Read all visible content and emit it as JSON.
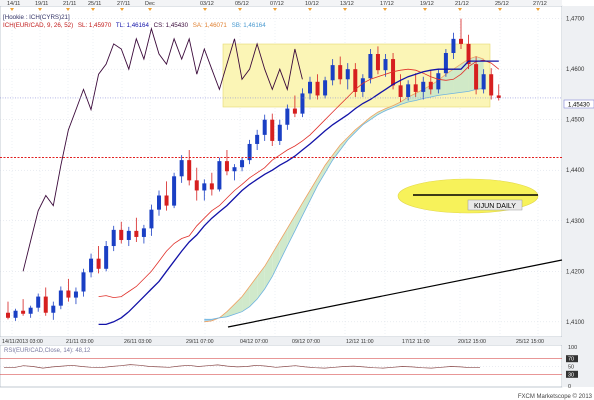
{
  "window": {
    "title_tag": "[Hookie : ICH(CYRS)21]"
  },
  "legend": {
    "ichimoku_line": "ICH(EUR/CAD, 9, 26, 52)",
    "sl_label": "SL: 1,45970",
    "tl_label": "TL: 1,46164",
    "cs_label": "CS: 1,45430",
    "sa_label": "SA: 1,46071",
    "sb_label": "SB: 1,46164"
  },
  "annotation": {
    "kijun_label": "KIJUN DAILY"
  },
  "rsi": {
    "label": "RSI(EUR/CAD,Close, 14): 48,12",
    "tick_labels": [
      "100",
      "70",
      "50",
      "30",
      "0"
    ],
    "ticks": [
      100,
      70,
      50,
      30,
      0
    ]
  },
  "footer": {
    "credit": "FXCM Marketscope © 2013"
  },
  "colors": {
    "candle_up": "#1a3fc4",
    "candle_down": "#d61f1f",
    "tenkan": "#e0302a",
    "kijun": "#1313a8",
    "chikou": "#3b0a3b",
    "cloud_bear": "#9fd4ef",
    "cloud_bull": "#cde8c8",
    "span_a": "#f0a060",
    "span_b": "#6fb3e0",
    "highlight_box": "#fbf5b6",
    "ellipse": "#f7f25a",
    "support_line": "#dd0000",
    "trendline": "#000000"
  },
  "chart_data": {
    "type": "candlestick",
    "instrument": "EUR/CAD",
    "y_ticks": [
      1.41,
      1.42,
      1.43,
      1.44,
      1.45,
      1.46,
      1.47
    ],
    "y_tick_labels": [
      "1,4100",
      "1,4200",
      "1,4300",
      "1,4400",
      "1,4500",
      "1,4600",
      "1,4700"
    ],
    "ylim": [
      1.407,
      1.4725
    ],
    "current_price": 1.4543,
    "current_price_label": "1,45430",
    "horizontal_support": 1.4425,
    "top_date_labels": [
      "14/11",
      "19/11",
      "21/11",
      "25/11",
      "27/11",
      "Dec",
      "03/12",
      "05/12",
      "07/12",
      "10/12",
      "13/12",
      "17/12",
      "19/12",
      "21/12",
      "25/12",
      "27/12"
    ],
    "bottom_date_labels": [
      "14/11/2013 03:00",
      "21/11 03:00",
      "26/11 03:00",
      "29/11 07:00",
      "04/12 07:00",
      "09/12 07:00",
      "12/12 11:00",
      "17/12 11:00",
      "20/12 15:00",
      "25/12 15:00"
    ],
    "candles": [
      {
        "o": 1.4118,
        "h": 1.414,
        "l": 1.4105,
        "c": 1.4108
      },
      {
        "o": 1.4108,
        "h": 1.4126,
        "l": 1.4102,
        "c": 1.4122
      },
      {
        "o": 1.4122,
        "h": 1.4145,
        "l": 1.4112,
        "c": 1.4116
      },
      {
        "o": 1.4116,
        "h": 1.4132,
        "l": 1.4108,
        "c": 1.4128
      },
      {
        "o": 1.4128,
        "h": 1.4156,
        "l": 1.412,
        "c": 1.415
      },
      {
        "o": 1.415,
        "h": 1.4168,
        "l": 1.4112,
        "c": 1.4118
      },
      {
        "o": 1.4118,
        "h": 1.414,
        "l": 1.4104,
        "c": 1.4132
      },
      {
        "o": 1.4132,
        "h": 1.417,
        "l": 1.4125,
        "c": 1.4162
      },
      {
        "o": 1.4162,
        "h": 1.4185,
        "l": 1.414,
        "c": 1.4148
      },
      {
        "o": 1.4148,
        "h": 1.4168,
        "l": 1.4135,
        "c": 1.416
      },
      {
        "o": 1.416,
        "h": 1.4205,
        "l": 1.415,
        "c": 1.4198
      },
      {
        "o": 1.4198,
        "h": 1.4235,
        "l": 1.4188,
        "c": 1.4225
      },
      {
        "o": 1.4225,
        "h": 1.425,
        "l": 1.4196,
        "c": 1.4205
      },
      {
        "o": 1.4205,
        "h": 1.426,
        "l": 1.42,
        "c": 1.425
      },
      {
        "o": 1.425,
        "h": 1.429,
        "l": 1.424,
        "c": 1.4282
      },
      {
        "o": 1.4282,
        "h": 1.4298,
        "l": 1.4255,
        "c": 1.4262
      },
      {
        "o": 1.4262,
        "h": 1.4288,
        "l": 1.425,
        "c": 1.428
      },
      {
        "o": 1.428,
        "h": 1.4306,
        "l": 1.4258,
        "c": 1.4268
      },
      {
        "o": 1.4268,
        "h": 1.4292,
        "l": 1.4255,
        "c": 1.4285
      },
      {
        "o": 1.4285,
        "h": 1.4332,
        "l": 1.427,
        "c": 1.4322
      },
      {
        "o": 1.4322,
        "h": 1.436,
        "l": 1.431,
        "c": 1.435
      },
      {
        "o": 1.435,
        "h": 1.4378,
        "l": 1.432,
        "c": 1.433
      },
      {
        "o": 1.433,
        "h": 1.4395,
        "l": 1.4325,
        "c": 1.4388
      },
      {
        "o": 1.4388,
        "h": 1.443,
        "l": 1.4375,
        "c": 1.442
      },
      {
        "o": 1.442,
        "h": 1.444,
        "l": 1.437,
        "c": 1.438
      },
      {
        "o": 1.438,
        "h": 1.4405,
        "l": 1.434,
        "c": 1.436
      },
      {
        "o": 1.436,
        "h": 1.4382,
        "l": 1.434,
        "c": 1.4374
      },
      {
        "o": 1.4374,
        "h": 1.4395,
        "l": 1.435,
        "c": 1.4362
      },
      {
        "o": 1.4362,
        "h": 1.4425,
        "l": 1.4358,
        "c": 1.4418
      },
      {
        "o": 1.4418,
        "h": 1.444,
        "l": 1.439,
        "c": 1.4398
      },
      {
        "o": 1.4398,
        "h": 1.4412,
        "l": 1.438,
        "c": 1.4406
      },
      {
        "o": 1.4406,
        "h": 1.4425,
        "l": 1.4398,
        "c": 1.442
      },
      {
        "o": 1.442,
        "h": 1.446,
        "l": 1.4412,
        "c": 1.4452
      },
      {
        "o": 1.4452,
        "h": 1.448,
        "l": 1.444,
        "c": 1.447
      },
      {
        "o": 1.447,
        "h": 1.451,
        "l": 1.4458,
        "c": 1.45
      },
      {
        "o": 1.45,
        "h": 1.4512,
        "l": 1.4448,
        "c": 1.4458
      },
      {
        "o": 1.4458,
        "h": 1.45,
        "l": 1.445,
        "c": 1.449
      },
      {
        "o": 1.449,
        "h": 1.453,
        "l": 1.448,
        "c": 1.4522
      },
      {
        "o": 1.4522,
        "h": 1.4548,
        "l": 1.4505,
        "c": 1.4512
      },
      {
        "o": 1.4512,
        "h": 1.4562,
        "l": 1.4505,
        "c": 1.4552
      },
      {
        "o": 1.4552,
        "h": 1.4585,
        "l": 1.454,
        "c": 1.4575
      },
      {
        "o": 1.4575,
        "h": 1.459,
        "l": 1.454,
        "c": 1.4548
      },
      {
        "o": 1.4548,
        "h": 1.4585,
        "l": 1.4542,
        "c": 1.4578
      },
      {
        "o": 1.4578,
        "h": 1.462,
        "l": 1.4568,
        "c": 1.4608
      },
      {
        "o": 1.4608,
        "h": 1.4625,
        "l": 1.457,
        "c": 1.458
      },
      {
        "o": 1.458,
        "h": 1.4612,
        "l": 1.456,
        "c": 1.46
      },
      {
        "o": 1.46,
        "h": 1.4612,
        "l": 1.4545,
        "c": 1.4555
      },
      {
        "o": 1.4555,
        "h": 1.459,
        "l": 1.4545,
        "c": 1.4582
      },
      {
        "o": 1.4582,
        "h": 1.464,
        "l": 1.4572,
        "c": 1.463
      },
      {
        "o": 1.463,
        "h": 1.4645,
        "l": 1.459,
        "c": 1.4598
      },
      {
        "o": 1.4598,
        "h": 1.463,
        "l": 1.4585,
        "c": 1.462
      },
      {
        "o": 1.462,
        "h": 1.4632,
        "l": 1.456,
        "c": 1.4568
      },
      {
        "o": 1.4568,
        "h": 1.459,
        "l": 1.4535,
        "c": 1.4545
      },
      {
        "o": 1.4545,
        "h": 1.4578,
        "l": 1.4538,
        "c": 1.457
      },
      {
        "o": 1.457,
        "h": 1.4592,
        "l": 1.4545,
        "c": 1.4555
      },
      {
        "o": 1.4555,
        "h": 1.4585,
        "l": 1.454,
        "c": 1.4575
      },
      {
        "o": 1.4575,
        "h": 1.4598,
        "l": 1.455,
        "c": 1.456
      },
      {
        "o": 1.456,
        "h": 1.46,
        "l": 1.4552,
        "c": 1.4592
      },
      {
        "o": 1.4592,
        "h": 1.464,
        "l": 1.4585,
        "c": 1.4632
      },
      {
        "o": 1.4632,
        "h": 1.4672,
        "l": 1.462,
        "c": 1.466
      },
      {
        "o": 1.466,
        "h": 1.47,
        "l": 1.464,
        "c": 1.465
      },
      {
        "o": 1.465,
        "h": 1.4668,
        "l": 1.46,
        "c": 1.461
      },
      {
        "o": 1.461,
        "h": 1.4625,
        "l": 1.455,
        "c": 1.456
      },
      {
        "o": 1.456,
        "h": 1.46,
        "l": 1.4552,
        "c": 1.459
      },
      {
        "o": 1.459,
        "h": 1.4602,
        "l": 1.454,
        "c": 1.4548
      },
      {
        "o": 1.4548,
        "h": 1.457,
        "l": 1.4538,
        "c": 1.4543
      }
    ],
    "tenkan": [
      1.415,
      1.4152,
      1.4148,
      1.415,
      1.416,
      1.417,
      1.4185,
      1.42,
      1.422,
      1.424,
      1.4255,
      1.4265,
      1.427,
      1.429,
      1.4305,
      1.432,
      1.433,
      1.4345,
      1.436,
      1.4372,
      1.4385,
      1.4395,
      1.4405,
      1.442,
      1.443,
      1.444,
      1.4448,
      1.4458,
      1.447,
      1.4485,
      1.45,
      1.4515,
      1.453,
      1.4545,
      1.456,
      1.4572,
      1.458,
      1.4585,
      1.459,
      1.4595,
      1.4598,
      1.46,
      1.4598,
      1.4592,
      1.4585,
      1.458,
      1.4578,
      1.458,
      1.459,
      1.4605,
      1.4615,
      1.4618,
      1.4612,
      1.46
    ],
    "kijun": [
      1.4095,
      1.4095,
      1.41,
      1.4108,
      1.412,
      1.4135,
      1.415,
      1.4165,
      1.418,
      1.42,
      1.422,
      1.424,
      1.4258,
      1.4272,
      1.429,
      1.4305,
      1.4318,
      1.433,
      1.4345,
      1.436,
      1.4372,
      1.4382,
      1.4392,
      1.44,
      1.441,
      1.4418,
      1.4428,
      1.444,
      1.4452,
      1.4465,
      1.4478,
      1.449,
      1.45,
      1.451,
      1.4522,
      1.4532,
      1.454,
      1.455,
      1.456,
      1.457,
      1.4578,
      1.4585,
      1.459,
      1.4595,
      1.4598,
      1.46,
      1.46,
      1.46,
      1.46,
      1.4616,
      1.4616,
      1.4616,
      1.4616,
      1.4616
    ],
    "chikou": [
      1.42,
      1.426,
      1.432,
      1.435,
      1.433,
      1.441,
      1.448,
      1.452,
      1.456,
      1.452,
      1.459,
      1.461,
      1.465,
      1.464,
      1.46,
      1.466,
      1.462,
      1.468,
      1.463,
      1.461,
      1.466,
      1.462,
      1.466,
      1.459,
      1.464,
      1.46,
      1.456,
      1.461,
      1.466,
      1.458,
      1.46,
      1.465,
      1.46,
      1.456,
      1.46,
      1.456,
      1.464,
      1.458
    ],
    "span_a": [
      1.41,
      1.4102,
      1.4108,
      1.412,
      1.4135,
      1.415,
      1.417,
      1.419,
      1.421,
      1.4235,
      1.426,
      1.4285,
      1.431,
      1.4335,
      1.436,
      1.4385,
      1.441,
      1.443,
      1.445,
      1.4465,
      1.448,
      1.4492,
      1.4505,
      1.4515,
      1.4522,
      1.4528,
      1.4535,
      1.4545,
      1.4552,
      1.456,
      1.4568,
      1.4578,
      1.459,
      1.46,
      1.461,
      1.462,
      1.4625,
      1.462
    ],
    "span_b": [
      1.4105,
      1.4105,
      1.4108,
      1.411,
      1.4115,
      1.412,
      1.413,
      1.4145,
      1.4165,
      1.419,
      1.422,
      1.425,
      1.428,
      1.431,
      1.434,
      1.437,
      1.4395,
      1.442,
      1.444,
      1.446,
      1.4475,
      1.449,
      1.45,
      1.451,
      1.4518,
      1.4524,
      1.453,
      1.4535,
      1.4538,
      1.4542,
      1.4545,
      1.4548,
      1.455,
      1.4552,
      1.4554,
      1.4556,
      1.456,
      1.4562
    ],
    "rsi_values": [
      48,
      47,
      52,
      50,
      46,
      49,
      51,
      53,
      50,
      48,
      47,
      50,
      52,
      55,
      53,
      50,
      49,
      48,
      51,
      53,
      50,
      52,
      54,
      51,
      49,
      50,
      53,
      51,
      48,
      50,
      52,
      49,
      47,
      46,
      48,
      50,
      51,
      49,
      47,
      46,
      48,
      50,
      49,
      47,
      46,
      48,
      50,
      49,
      47,
      48
    ]
  }
}
